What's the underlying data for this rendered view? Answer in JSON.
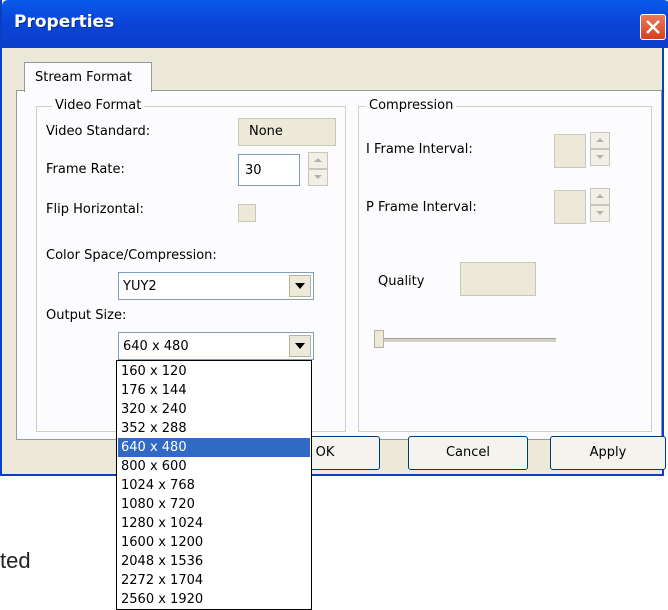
{
  "window": {
    "title": "Properties"
  },
  "tabs": [
    {
      "label": "Stream Format"
    }
  ],
  "video_format": {
    "legend": "Video Format",
    "video_standard_label": "Video Standard:",
    "video_standard_value": "None",
    "frame_rate_label": "Frame Rate:",
    "frame_rate_value": "30",
    "flip_horizontal_label": "Flip Horizontal:",
    "color_space_label": "Color Space/Compression:",
    "color_space_value": "YUY2",
    "output_size_label": "Output Size:",
    "output_size_value": "640 x 480"
  },
  "compression": {
    "legend": "Compression",
    "i_frame_label": "I Frame Interval:",
    "p_frame_label": "P Frame Interval:",
    "quality_label": "Quality"
  },
  "buttons": {
    "ok": "OK",
    "cancel": "Cancel",
    "apply": "Apply"
  },
  "output_size_options": [
    "160 x 120",
    "176 x 144",
    "320 x 240",
    "352 x 288",
    "640 x 480",
    "800 x 600",
    "1024 x 768",
    "1080 x 720",
    "1280 x 1024",
    "1600 x 1200",
    "2048 x 1536",
    "2272 x 1704",
    "2560 x 1920"
  ],
  "output_size_selected_index": 4,
  "background_text": "ted",
  "icons": [
    "close-icon",
    "spin-up-icon",
    "spin-down-icon",
    "dropdown-arrow-icon"
  ],
  "colors": {
    "titlebar": "#0a45d8",
    "selection": "#316ac5",
    "dialog_bg": "#ece9d8"
  }
}
